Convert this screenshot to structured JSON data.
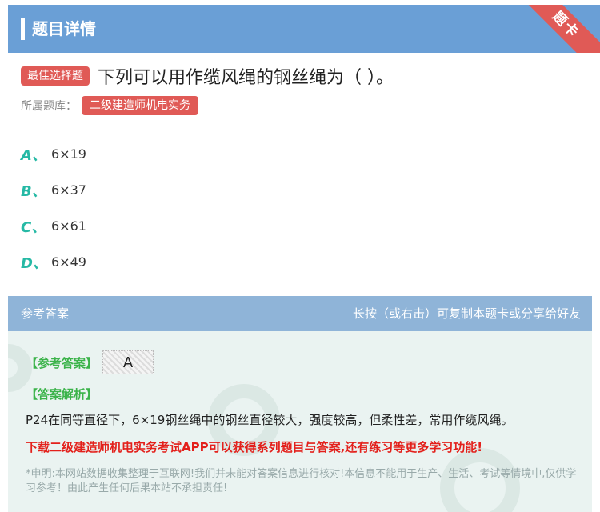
{
  "header": {
    "title": "题目详情",
    "ribbon": "题卡"
  },
  "question": {
    "type_badge": "最佳选择题",
    "text": "下列可以用作缆风绳的钢丝绳为（   ）。",
    "bank_label": "所属题库：",
    "bank_name": "二级建造师机电实务"
  },
  "options": [
    {
      "letter": "A、",
      "text": "6×19"
    },
    {
      "letter": "B、",
      "text": "6×37"
    },
    {
      "letter": "C、",
      "text": "6×61"
    },
    {
      "letter": "D、",
      "text": "6×49"
    }
  ],
  "answer_panel": {
    "header_left": "参考答案",
    "header_right": "长按（或右击）可复制本题卡或分享给好友",
    "ref_label": "【参考答案】",
    "ref_value": "A",
    "analysis_label": "【答案解析】",
    "analysis_text": "P24在同等直径下，6×19钢丝绳中的钢丝直径较大，强度较高，但柔性差，常用作缆风绳。",
    "promo_text": "下载二级建造师机电实务考试APP可以获得系列题目与答案,还有练习等更多学习功能!",
    "disclaimer": "*申明:本网站数据收集整理于互联网!我们并未能对答案信息进行核对!本信息不能用于生产、生活、考试等情境中,仅供学习参考！由此产生任何后果本站不承担责任!"
  },
  "colors": {
    "header": "#6a9fd6",
    "accent_red": "#e05a56",
    "option_letter": "#26b9a5",
    "answer_green": "#3bb34a",
    "promo_red": "#e3201b"
  }
}
